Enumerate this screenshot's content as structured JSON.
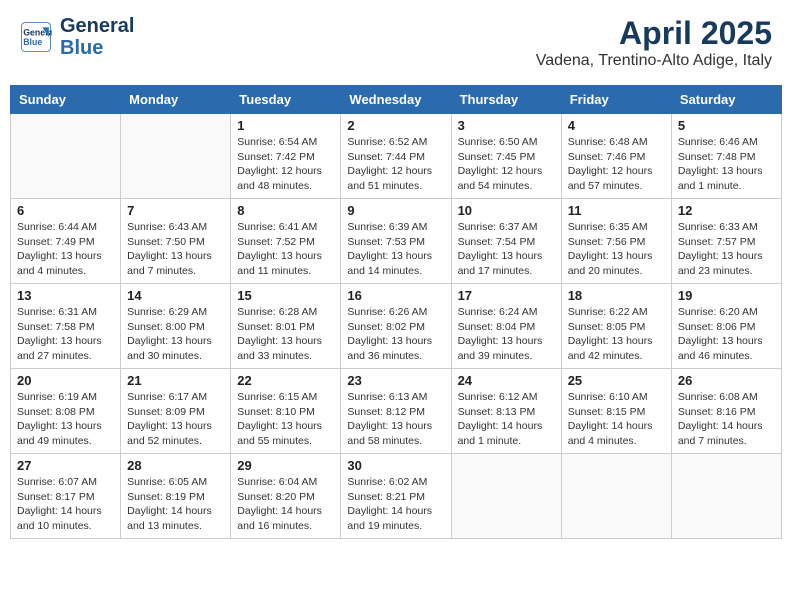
{
  "header": {
    "logo_line1": "General",
    "logo_line2": "Blue",
    "title": "April 2025",
    "subtitle": "Vadena, Trentino-Alto Adige, Italy"
  },
  "days_of_week": [
    "Sunday",
    "Monday",
    "Tuesday",
    "Wednesday",
    "Thursday",
    "Friday",
    "Saturday"
  ],
  "weeks": [
    [
      {
        "day": "",
        "empty": true
      },
      {
        "day": "",
        "empty": true
      },
      {
        "day": "1",
        "line1": "Sunrise: 6:54 AM",
        "line2": "Sunset: 7:42 PM",
        "line3": "Daylight: 12 hours and 48 minutes."
      },
      {
        "day": "2",
        "line1": "Sunrise: 6:52 AM",
        "line2": "Sunset: 7:44 PM",
        "line3": "Daylight: 12 hours and 51 minutes."
      },
      {
        "day": "3",
        "line1": "Sunrise: 6:50 AM",
        "line2": "Sunset: 7:45 PM",
        "line3": "Daylight: 12 hours and 54 minutes."
      },
      {
        "day": "4",
        "line1": "Sunrise: 6:48 AM",
        "line2": "Sunset: 7:46 PM",
        "line3": "Daylight: 12 hours and 57 minutes."
      },
      {
        "day": "5",
        "line1": "Sunrise: 6:46 AM",
        "line2": "Sunset: 7:48 PM",
        "line3": "Daylight: 13 hours and 1 minute."
      }
    ],
    [
      {
        "day": "6",
        "line1": "Sunrise: 6:44 AM",
        "line2": "Sunset: 7:49 PM",
        "line3": "Daylight: 13 hours and 4 minutes."
      },
      {
        "day": "7",
        "line1": "Sunrise: 6:43 AM",
        "line2": "Sunset: 7:50 PM",
        "line3": "Daylight: 13 hours and 7 minutes."
      },
      {
        "day": "8",
        "line1": "Sunrise: 6:41 AM",
        "line2": "Sunset: 7:52 PM",
        "line3": "Daylight: 13 hours and 11 minutes."
      },
      {
        "day": "9",
        "line1": "Sunrise: 6:39 AM",
        "line2": "Sunset: 7:53 PM",
        "line3": "Daylight: 13 hours and 14 minutes."
      },
      {
        "day": "10",
        "line1": "Sunrise: 6:37 AM",
        "line2": "Sunset: 7:54 PM",
        "line3": "Daylight: 13 hours and 17 minutes."
      },
      {
        "day": "11",
        "line1": "Sunrise: 6:35 AM",
        "line2": "Sunset: 7:56 PM",
        "line3": "Daylight: 13 hours and 20 minutes."
      },
      {
        "day": "12",
        "line1": "Sunrise: 6:33 AM",
        "line2": "Sunset: 7:57 PM",
        "line3": "Daylight: 13 hours and 23 minutes."
      }
    ],
    [
      {
        "day": "13",
        "line1": "Sunrise: 6:31 AM",
        "line2": "Sunset: 7:58 PM",
        "line3": "Daylight: 13 hours and 27 minutes."
      },
      {
        "day": "14",
        "line1": "Sunrise: 6:29 AM",
        "line2": "Sunset: 8:00 PM",
        "line3": "Daylight: 13 hours and 30 minutes."
      },
      {
        "day": "15",
        "line1": "Sunrise: 6:28 AM",
        "line2": "Sunset: 8:01 PM",
        "line3": "Daylight: 13 hours and 33 minutes."
      },
      {
        "day": "16",
        "line1": "Sunrise: 6:26 AM",
        "line2": "Sunset: 8:02 PM",
        "line3": "Daylight: 13 hours and 36 minutes."
      },
      {
        "day": "17",
        "line1": "Sunrise: 6:24 AM",
        "line2": "Sunset: 8:04 PM",
        "line3": "Daylight: 13 hours and 39 minutes."
      },
      {
        "day": "18",
        "line1": "Sunrise: 6:22 AM",
        "line2": "Sunset: 8:05 PM",
        "line3": "Daylight: 13 hours and 42 minutes."
      },
      {
        "day": "19",
        "line1": "Sunrise: 6:20 AM",
        "line2": "Sunset: 8:06 PM",
        "line3": "Daylight: 13 hours and 46 minutes."
      }
    ],
    [
      {
        "day": "20",
        "line1": "Sunrise: 6:19 AM",
        "line2": "Sunset: 8:08 PM",
        "line3": "Daylight: 13 hours and 49 minutes."
      },
      {
        "day": "21",
        "line1": "Sunrise: 6:17 AM",
        "line2": "Sunset: 8:09 PM",
        "line3": "Daylight: 13 hours and 52 minutes."
      },
      {
        "day": "22",
        "line1": "Sunrise: 6:15 AM",
        "line2": "Sunset: 8:10 PM",
        "line3": "Daylight: 13 hours and 55 minutes."
      },
      {
        "day": "23",
        "line1": "Sunrise: 6:13 AM",
        "line2": "Sunset: 8:12 PM",
        "line3": "Daylight: 13 hours and 58 minutes."
      },
      {
        "day": "24",
        "line1": "Sunrise: 6:12 AM",
        "line2": "Sunset: 8:13 PM",
        "line3": "Daylight: 14 hours and 1 minute."
      },
      {
        "day": "25",
        "line1": "Sunrise: 6:10 AM",
        "line2": "Sunset: 8:15 PM",
        "line3": "Daylight: 14 hours and 4 minutes."
      },
      {
        "day": "26",
        "line1": "Sunrise: 6:08 AM",
        "line2": "Sunset: 8:16 PM",
        "line3": "Daylight: 14 hours and 7 minutes."
      }
    ],
    [
      {
        "day": "27",
        "line1": "Sunrise: 6:07 AM",
        "line2": "Sunset: 8:17 PM",
        "line3": "Daylight: 14 hours and 10 minutes."
      },
      {
        "day": "28",
        "line1": "Sunrise: 6:05 AM",
        "line2": "Sunset: 8:19 PM",
        "line3": "Daylight: 14 hours and 13 minutes."
      },
      {
        "day": "29",
        "line1": "Sunrise: 6:04 AM",
        "line2": "Sunset: 8:20 PM",
        "line3": "Daylight: 14 hours and 16 minutes."
      },
      {
        "day": "30",
        "line1": "Sunrise: 6:02 AM",
        "line2": "Sunset: 8:21 PM",
        "line3": "Daylight: 14 hours and 19 minutes."
      },
      {
        "day": "",
        "empty": true
      },
      {
        "day": "",
        "empty": true
      },
      {
        "day": "",
        "empty": true
      }
    ]
  ]
}
